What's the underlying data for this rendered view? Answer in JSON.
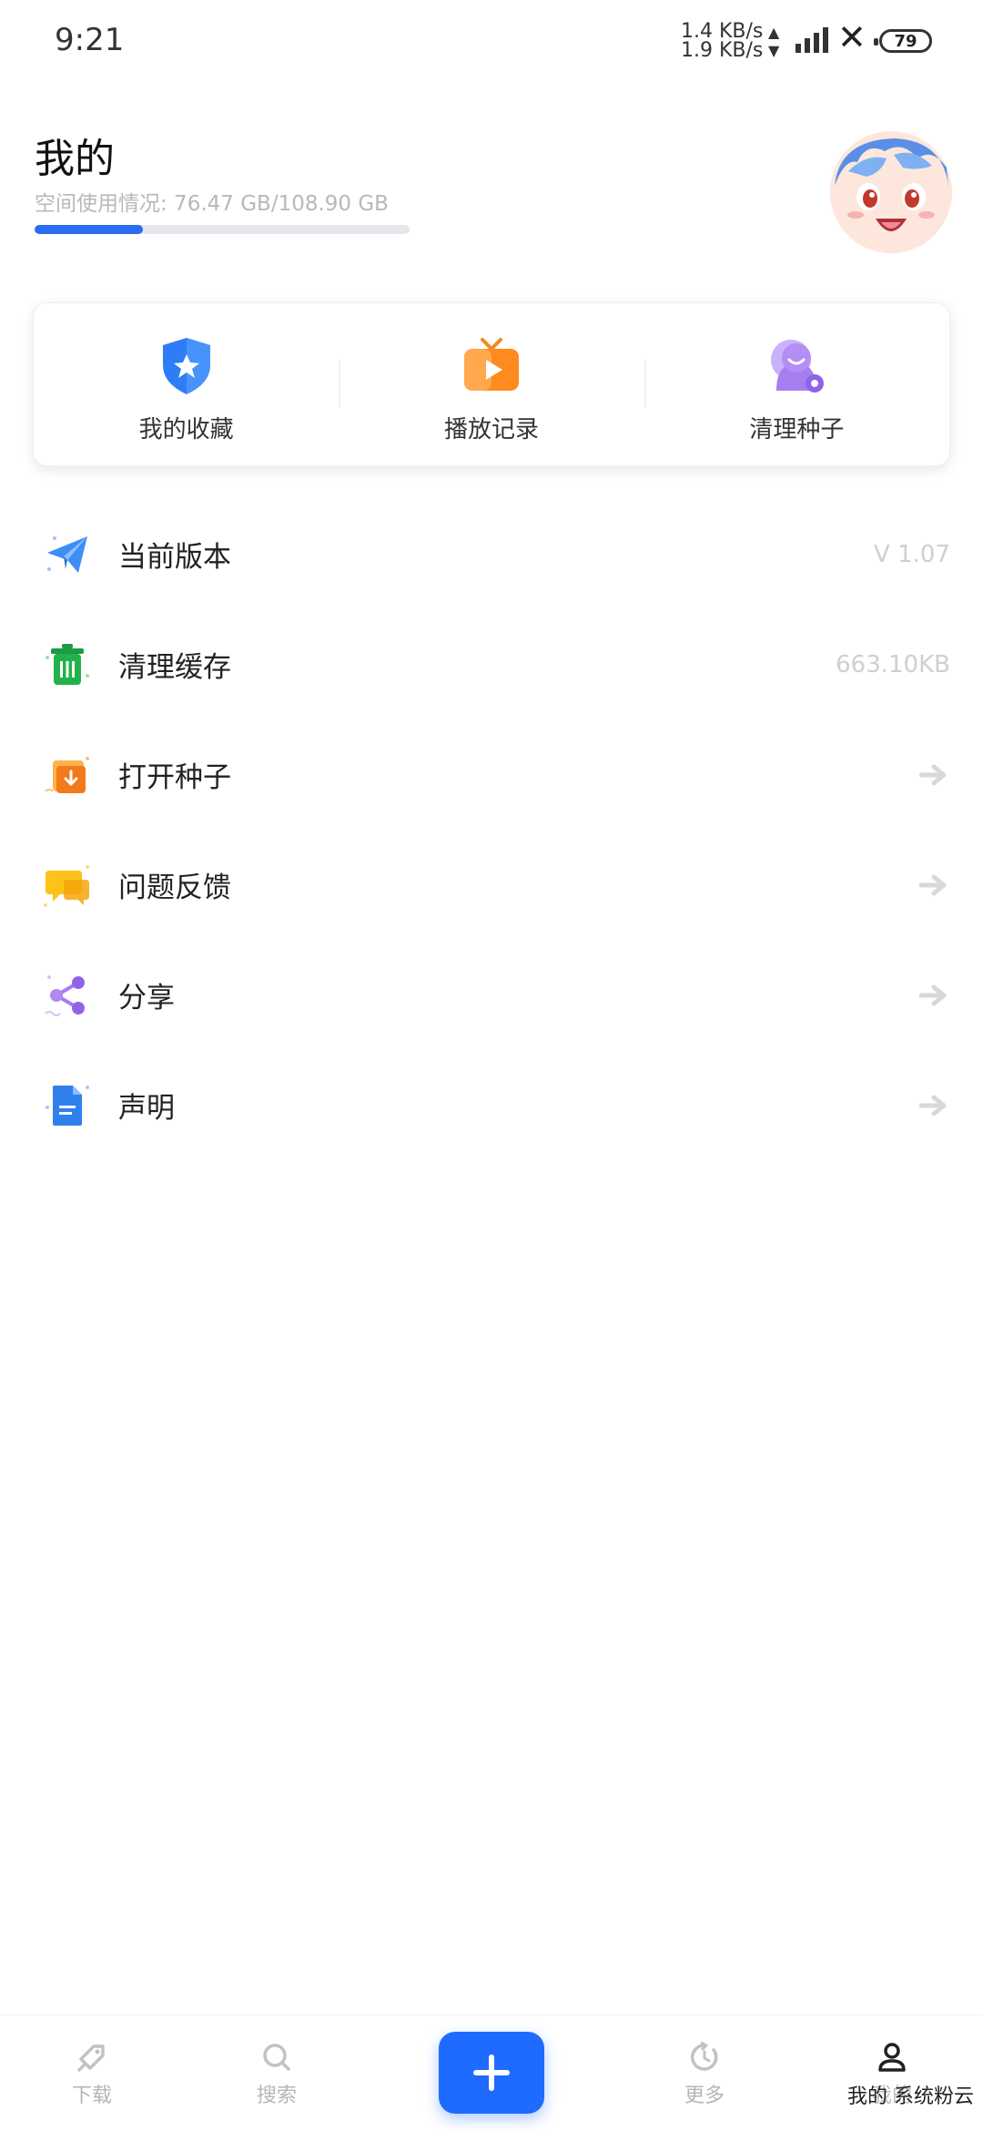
{
  "status_bar": {
    "time": "9:21",
    "speed_up": "1.4 KB/s",
    "speed_down": "1.9 KB/s",
    "battery": "79"
  },
  "header": {
    "title": "我的",
    "storage_label": "空间使用情况: 76.47 GB/108.90 GB",
    "storage_fraction": 0.29
  },
  "quick_actions": [
    {
      "label": "我的收藏",
      "icon": "shield-star-icon"
    },
    {
      "label": "播放记录",
      "icon": "tv-play-icon"
    },
    {
      "label": "清理种子",
      "icon": "seed-clean-icon"
    }
  ],
  "menu": [
    {
      "label": "当前版本",
      "value": "V 1.07",
      "icon": "paper-plane-icon"
    },
    {
      "label": "清理缓存",
      "value": "663.10KB",
      "icon": "trash-icon"
    },
    {
      "label": "打开种子",
      "value": "",
      "icon": "open-file-icon"
    },
    {
      "label": "问题反馈",
      "value": "",
      "icon": "chat-bubbles-icon"
    },
    {
      "label": "分享",
      "value": "",
      "icon": "share-icon"
    },
    {
      "label": "声明",
      "value": "",
      "icon": "document-icon"
    }
  ],
  "bottom_nav": [
    {
      "label": "下载",
      "icon": "tag-icon",
      "active": false
    },
    {
      "label": "搜索",
      "icon": "search-icon",
      "active": false
    },
    {
      "label": "更多",
      "icon": "refresh-icon",
      "active": false
    },
    {
      "label": "我的",
      "icon": "user-icon",
      "active": true
    }
  ],
  "watermark": "我的 系统粉云",
  "colors": {
    "accent": "#1f6bff",
    "progress": "#2c6cf0",
    "muted_text": "#cfcfcf"
  }
}
